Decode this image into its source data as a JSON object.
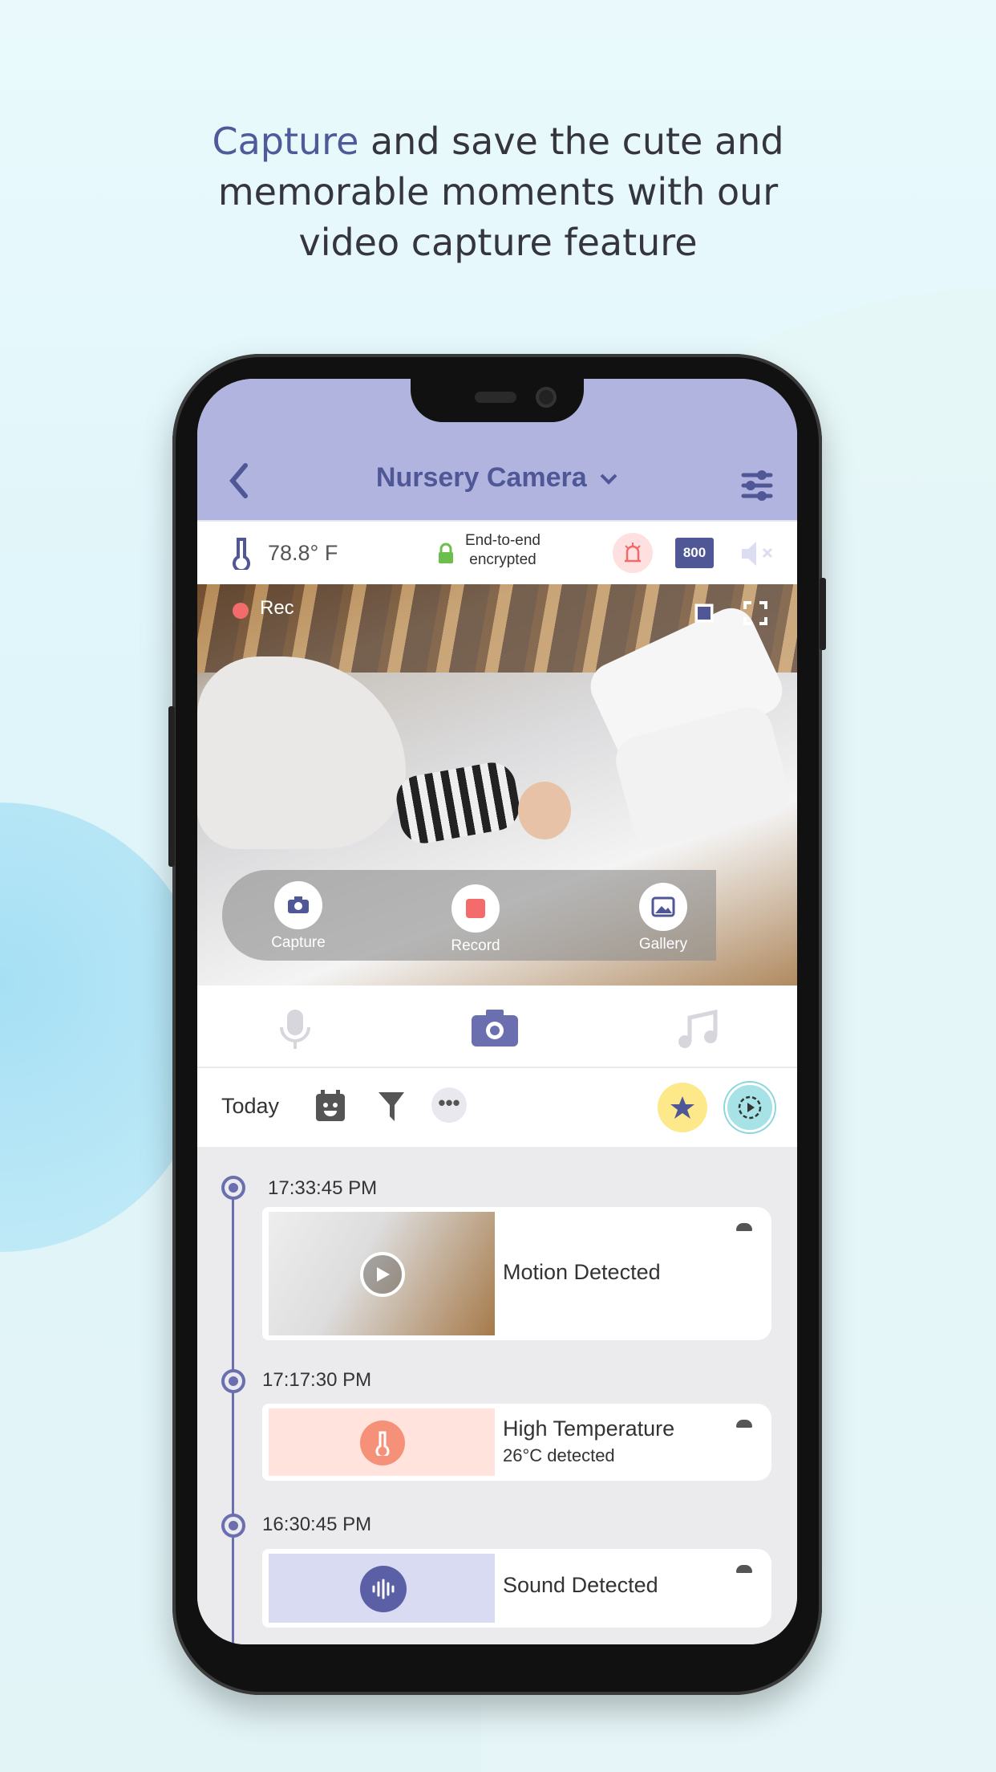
{
  "headline": {
    "accent": "Capture",
    "line1_rest": " and save the cute and",
    "line2": "memorable moments with our",
    "line3": "video capture feature"
  },
  "header": {
    "title": "Nursery Camera",
    "back_icon": "chevron-left-icon",
    "dropdown_icon": "chevron-down-icon",
    "settings_icon": "sliders-icon"
  },
  "status": {
    "temperature": "78.8° F",
    "encryption_line1": "End-to-end",
    "encryption_line2": "encrypted",
    "badge": "800",
    "alarm_color": "#f06a6a"
  },
  "video": {
    "rec_label": "Rec",
    "rec_color": "#f36b6b",
    "controls": {
      "capture": "Capture",
      "record": "Record",
      "gallery": "Gallery"
    }
  },
  "tabs": {
    "items": [
      "microphone",
      "camera",
      "music"
    ],
    "active": "camera"
  },
  "filter": {
    "date_label": "Today"
  },
  "events": [
    {
      "time": "17:33:45 PM",
      "title": "Motion Detected",
      "subtitle": ""
    },
    {
      "time": "17:17:30 PM",
      "title": "High Temperature",
      "subtitle": "26°C  detected"
    },
    {
      "time": "16:30:45 PM",
      "title": "Sound Detected",
      "subtitle": ""
    }
  ],
  "colors": {
    "accent": "#4f5797",
    "header_bg": "#b1b4de",
    "temp_card": "#ffe3dc",
    "sound_card": "#d9dbf2"
  }
}
